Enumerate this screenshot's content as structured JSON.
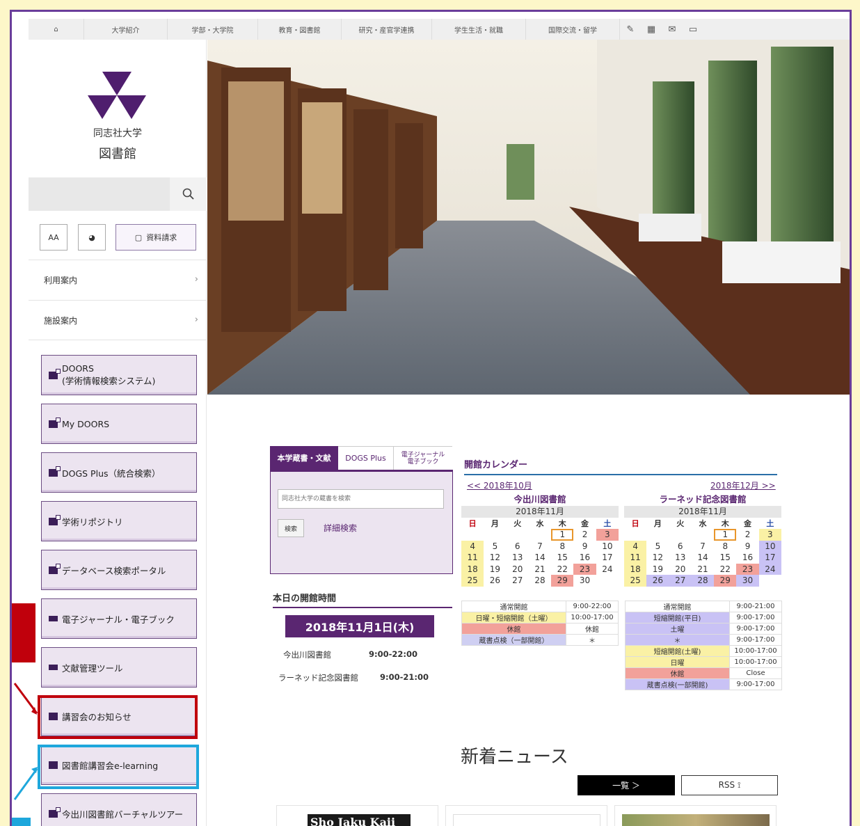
{
  "topnav": {
    "items": [
      "大学紹介",
      "学部・大学院",
      "教育・図書館",
      "研究・産官学連携",
      "学生生活・就職",
      "国際交流・留学"
    ]
  },
  "logo": {
    "line1": "同志社大学",
    "line2": "図書館"
  },
  "sidebar": {
    "search_placeholder": "",
    "tools": {
      "font_label": "AA",
      "request_label": "資料請求"
    },
    "menus": [
      "利用案内",
      "施設案内"
    ],
    "buttons": [
      {
        "line1": "DOORS",
        "line2": "(学術情報検索システム)"
      },
      {
        "label": "My DOORS"
      },
      {
        "label": "DOGS Plus（統合検索）"
      },
      {
        "label": "学術リポジトリ"
      },
      {
        "label": "データベース検索ポータル"
      },
      {
        "label": "電子ジャーナル・電子ブック"
      },
      {
        "label": "文献管理ツール"
      },
      {
        "label": "講習会のお知らせ"
      },
      {
        "label": "図書館講習会e-learning"
      },
      {
        "label": "今出川図書館バーチャルツアー"
      }
    ]
  },
  "search_tabs": {
    "tab1": "本学蔵書・文献",
    "tab2": "DOGS Plus",
    "tab3_line1": "電子ジャーナル",
    "tab3_line2": "電子ブック",
    "placeholder": "同志社大学の蔵書を検索",
    "search_button": "検索",
    "advanced": "詳細検索"
  },
  "hours": {
    "heading": "本日の開館時間",
    "date": "2018年11月1日(木)",
    "rows": [
      {
        "library": "今出川図書館",
        "time": "9:00-22:00"
      },
      {
        "library": "ラーネッド記念図書館",
        "time": "9:00-21:00"
      }
    ]
  },
  "calendar": {
    "heading": "開館カレンダー",
    "prev": "<< 2018年10月",
    "next": "2018年12月 >>",
    "weekdays": [
      "日",
      "月",
      "火",
      "水",
      "木",
      "金",
      "土"
    ],
    "libraries": [
      {
        "name": "今出川図書館",
        "month": "2018年11月",
        "weeks": [
          [
            "",
            "",
            "",
            "",
            "1",
            "2",
            "3"
          ],
          [
            "4",
            "5",
            "6",
            "7",
            "8",
            "9",
            "10"
          ],
          [
            "11",
            "12",
            "13",
            "14",
            "15",
            "16",
            "17"
          ],
          [
            "18",
            "19",
            "20",
            "21",
            "22",
            "23",
            "24"
          ],
          [
            "25",
            "26",
            "27",
            "28",
            "29",
            "30",
            ""
          ]
        ],
        "legend": [
          {
            "label": "通常開館",
            "time": "9:00-22:00",
            "color": "#ffffff"
          },
          {
            "label": "日曜・短縮開館（土曜）",
            "time": "10:00-17:00",
            "color": "#faf1a5"
          },
          {
            "label": "休館",
            "time": "休館",
            "color": "#f2a19a"
          },
          {
            "label": "蔵書点検（一部開館）",
            "time": "＊",
            "color": "#cfcff2"
          }
        ]
      },
      {
        "name": "ラーネッド記念図書館",
        "month": "2018年11月",
        "weeks": [
          [
            "",
            "",
            "",
            "",
            "1",
            "2",
            "3"
          ],
          [
            "4",
            "5",
            "6",
            "7",
            "8",
            "9",
            "10"
          ],
          [
            "11",
            "12",
            "13",
            "14",
            "15",
            "16",
            "17"
          ],
          [
            "18",
            "19",
            "20",
            "21",
            "22",
            "23",
            "24"
          ],
          [
            "25",
            "26",
            "27",
            "28",
            "29",
            "30",
            ""
          ]
        ],
        "legend": [
          {
            "label": "通常開館",
            "time": "9:00-21:00",
            "color": "#ffffff"
          },
          {
            "label": "短縮開館(平日)",
            "time": "9:00-17:00",
            "color": "#c9c2f5"
          },
          {
            "label": "土曜",
            "time": "9:00-17:00",
            "color": "#c9c2f5"
          },
          {
            "label": "＊",
            "time": "9:00-17:00",
            "color": "#c9c2f5"
          },
          {
            "label": "短縮開館(土曜)",
            "time": "10:00-17:00",
            "color": "#faf1a5"
          },
          {
            "label": "日曜",
            "time": "10:00-17:00",
            "color": "#faf1a5"
          },
          {
            "label": "休館",
            "time": "Close",
            "color": "#f2a19a"
          },
          {
            "label": "蔵書点検(一部開館)",
            "time": "9:00-17:00",
            "color": "#c9c2f5"
          }
        ]
      }
    ]
  },
  "news": {
    "heading": "新着ニュース",
    "all_label": "一覧 ＞",
    "rss_label": "RSS ⟟",
    "card1_text": "Sho Jaku Kaii"
  },
  "colors": {
    "brand_purple": "#5a2671",
    "highlight_red": "#c0000c",
    "highlight_blue": "#1ea7dc",
    "page_bg": "#fdf7c9"
  }
}
